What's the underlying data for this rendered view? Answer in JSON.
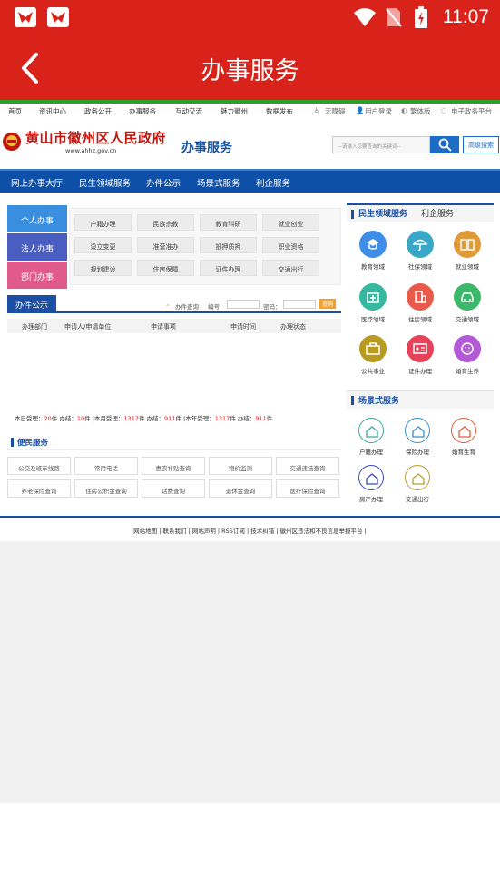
{
  "app": {
    "title": "办事服务",
    "time": "11:07"
  },
  "topnav": {
    "items": [
      "首页",
      "资讯中心",
      "政务公开",
      "办事服务",
      "互动交流",
      "魅力徽州",
      "数据发布"
    ],
    "utils": [
      "无障碍",
      "用户登录",
      "繁体版",
      "电子政务平台"
    ]
  },
  "header": {
    "site_name": "黄山市徽州区人民政府",
    "site_url": "www.ahhz.gov.cn",
    "section": "办事服务",
    "search_placeholder": "--请输入您要查询的关键词--",
    "advanced_search": "高级搜索"
  },
  "mainnav": [
    "网上办事大厅",
    "民生领域服务",
    "办件公示",
    "场景式服务",
    "利企服务"
  ],
  "lefttabs": [
    {
      "label": "个人办事",
      "color": "#3a8ee0"
    },
    {
      "label": "法人办事",
      "color": "#4a5dc0"
    },
    {
      "label": "部门办事",
      "color": "#e05b8a"
    }
  ],
  "services": [
    "户籍办理",
    "民族宗教",
    "教育科研",
    "就业创业",
    "设立变更",
    "准营准办",
    "抵押质押",
    "职业资格",
    "规划建设",
    "住房保障",
    "证件办理",
    "交通出行"
  ],
  "notice": {
    "tab": "办件公示",
    "query_label": "办件查询",
    "num_label": "编号：",
    "pwd_label": "密码：",
    "query_btn": "查询",
    "columns": [
      "办理部门",
      "申请人/申请单位",
      "申请事项",
      "申请时间",
      "办理状态"
    ]
  },
  "stats": {
    "today_label": "本日受理：",
    "today": "20",
    "unit": "件",
    "done_label": "办结：",
    "today_done": "10",
    "month_label": "|本月受理：",
    "month": "1317",
    "month_done": "911",
    "year_label": "|本年受理：",
    "year": "1317",
    "year_done": "911"
  },
  "bianmin": {
    "title": "便民服务",
    "items": [
      "公交及班车线路",
      "常用电话",
      "惠农补贴查询",
      "物价监测",
      "交通违法查询",
      "养老保险查询",
      "住房公积金查询",
      "话费查询",
      "退休金查询",
      "医疗保险查询"
    ]
  },
  "rightpanel": {
    "tab_active": "民生领域服务",
    "tab_other": "利企服务",
    "items": [
      {
        "label": "教育领域",
        "color": "#3e8ee8",
        "icon": "graduation-cap-icon"
      },
      {
        "label": "社保领域",
        "color": "#39a8c8",
        "icon": "umbrella-icon"
      },
      {
        "label": "就业领域",
        "color": "#e09a3a",
        "icon": "book-icon"
      },
      {
        "label": "医疗领域",
        "color": "#36b7a0",
        "icon": "medical-kit-icon"
      },
      {
        "label": "住房领域",
        "color": "#e85a4a",
        "icon": "building-icon"
      },
      {
        "label": "交通领域",
        "color": "#3bb86a",
        "icon": "car-icon"
      },
      {
        "label": "公共事业",
        "color": "#b79a20",
        "icon": "briefcase-icon"
      },
      {
        "label": "证件办理",
        "color": "#e8425a",
        "icon": "id-card-icon"
      },
      {
        "label": "婚育生养",
        "color": "#b45ad8",
        "icon": "baby-icon"
      }
    ]
  },
  "scene": {
    "title": "场景式服务",
    "items": [
      {
        "label": "户籍办理",
        "color": "#3aa6a0"
      },
      {
        "label": "保险办理",
        "color": "#3a8ec8"
      },
      {
        "label": "婚育生育",
        "color": "#e05a3a"
      },
      {
        "label": "房产办理",
        "color": "#3a4ab8"
      },
      {
        "label": "交通出行",
        "color": "#b8a030"
      }
    ]
  },
  "footer": {
    "links": "网站地图 | 联系我们 | 网站声明 | RSS订阅 | 技术纠错 | 徽州区违法和不良信息举报平台 |"
  }
}
